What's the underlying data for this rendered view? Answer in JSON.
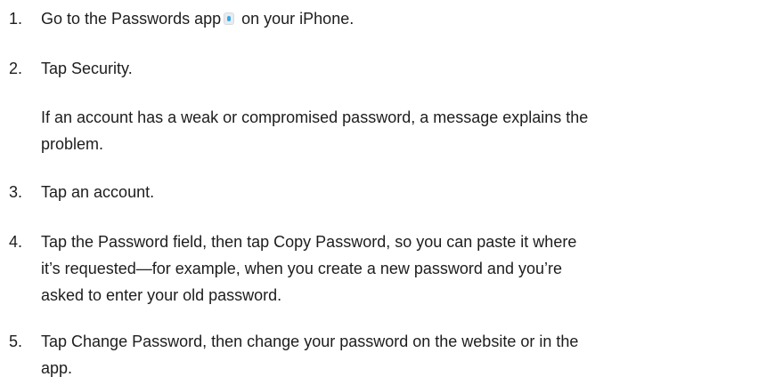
{
  "steps": [
    {
      "number": "1.",
      "before_icon": "Go to the Passwords app",
      "icon": "passwords-app-icon",
      "after_icon": " on your iPhone."
    },
    {
      "number": "2.",
      "text": "Tap Security."
    },
    {
      "note_lines": [
        "If an account has a weak or compromised password, a message explains the",
        "problem."
      ]
    },
    {
      "number": "3.",
      "text": "Tap an account."
    },
    {
      "number": "4.",
      "lines": [
        "Tap the Password field, then tap Copy Password, so you can paste it where",
        "it’s requested—for example, when you create a new password and you’re",
        "asked to enter your old password."
      ]
    },
    {
      "number": "5.",
      "lines": [
        "Tap Change Password, then change your password on the website or in the",
        "app."
      ]
    }
  ]
}
